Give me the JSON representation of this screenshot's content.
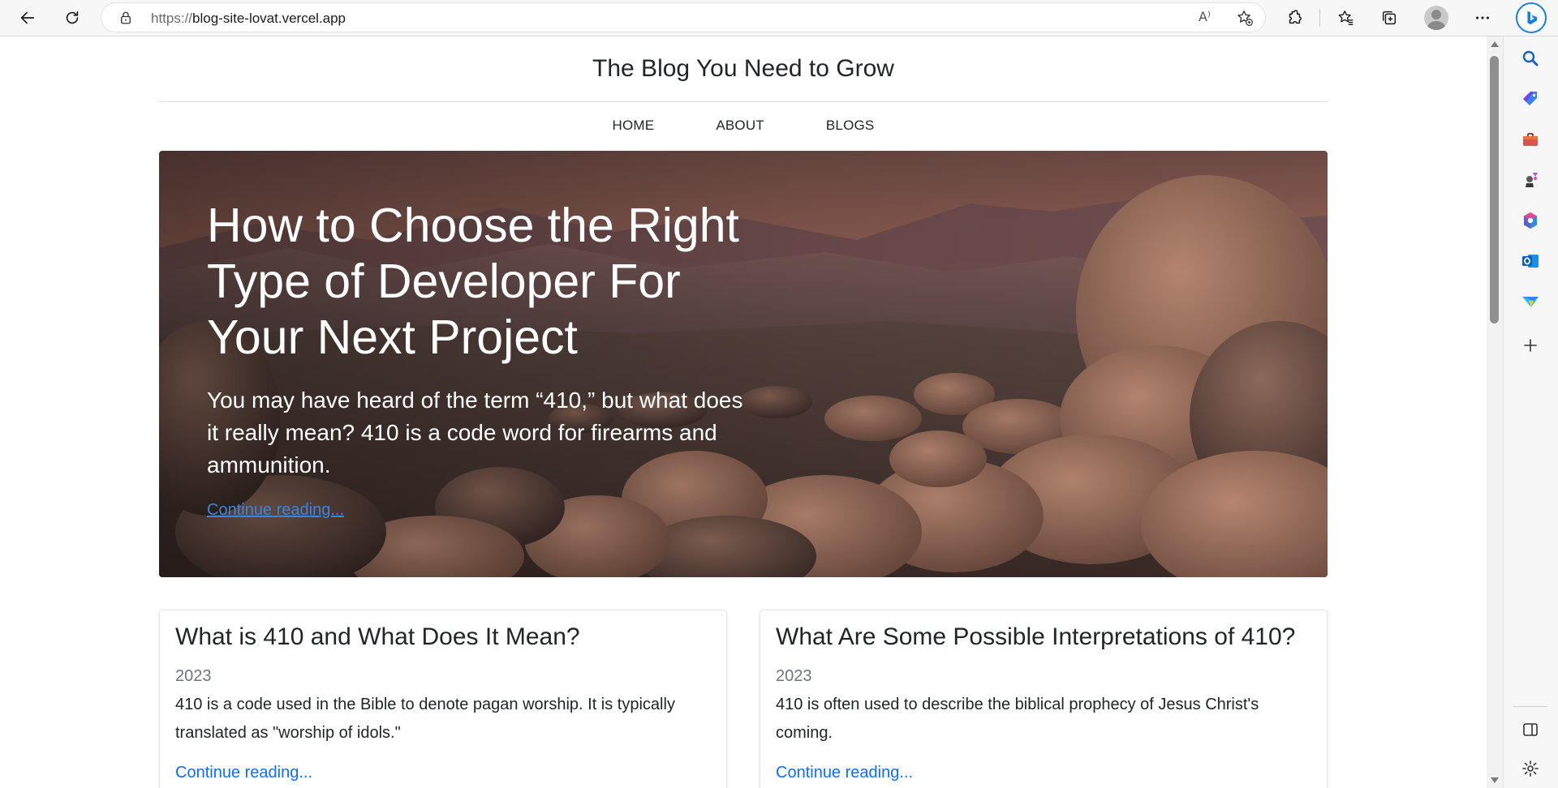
{
  "browser": {
    "url_scheme": "https://",
    "url_host": "blog-site-lovat.vercel.app",
    "read_aloud_label": "A⁾",
    "icons": [
      "back-icon",
      "refresh-icon",
      "lock-icon",
      "read-aloud-icon",
      "favorite-add-icon",
      "extensions-icon",
      "favorites-icon",
      "collections-icon",
      "profile-icon",
      "more-icon",
      "copilot-icon"
    ]
  },
  "sidebar": {
    "icons": [
      "search-icon",
      "shopping-tag-icon",
      "tools-briefcase-icon",
      "games-icon",
      "microsoft-365-icon",
      "outlook-icon",
      "drop-icon",
      "add-icon",
      "split-screen-icon",
      "settings-icon"
    ]
  },
  "site": {
    "title": "The Blog You Need to Grow",
    "nav": [
      "HOME",
      "ABOUT",
      "BLOGS"
    ]
  },
  "hero": {
    "title": "How to Choose the Right Type of Developer For Your Next Project",
    "lead": "You may have heard of the term “410,” but what does it really mean? 410 is a code word for firearms and ammunition.",
    "link": "Continue reading..."
  },
  "cards": [
    {
      "title": "What is 410 and What Does It Mean?",
      "year": "2023",
      "text": "410 is a code used in the Bible to denote pagan worship. It is typically translated as \"worship of idols.\"",
      "link": "Continue reading..."
    },
    {
      "title": "What Are Some Possible Interpretations of 410?",
      "year": "2023",
      "text": "410 is often used to describe the biblical prophecy of Jesus Christ's coming.",
      "link": "Continue reading..."
    }
  ],
  "colors": {
    "link_blue": "#0d6efd",
    "hero_link_blue": "#3f84d6",
    "edge_accent": "#1a7fe0"
  }
}
